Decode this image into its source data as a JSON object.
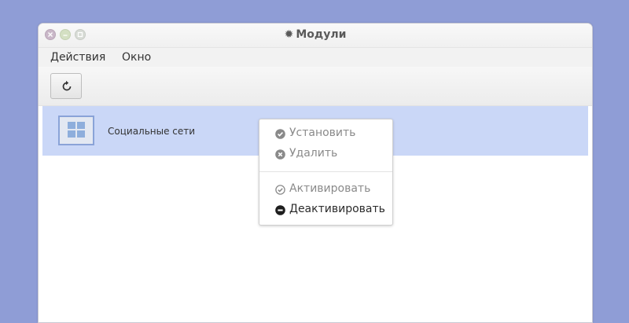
{
  "window": {
    "title": "Модули",
    "title_icon": "gear-icon",
    "controls": [
      "close",
      "minimize",
      "maximize"
    ]
  },
  "menubar": {
    "items": [
      {
        "label": "Действия"
      },
      {
        "label": "Окно"
      }
    ]
  },
  "toolbar": {
    "refresh_icon": "refresh-icon"
  },
  "modules": [
    {
      "name": "Социальные сети",
      "icon": "windows-icon",
      "selected": true
    }
  ],
  "context_menu": {
    "items": [
      {
        "label": "Установить",
        "icon": "check-circle-icon",
        "enabled": false
      },
      {
        "label": "Удалить",
        "icon": "cross-circle-icon",
        "enabled": false
      },
      {
        "label": "Активировать",
        "icon": "check-circle-outline-icon",
        "enabled": false
      },
      {
        "label": "Деактивировать",
        "icon": "minus-circle-icon",
        "enabled": true
      }
    ]
  },
  "colors": {
    "desktop": "#8f9dd6",
    "selection": "#cad7f7",
    "window_bg": "#ffffff"
  }
}
